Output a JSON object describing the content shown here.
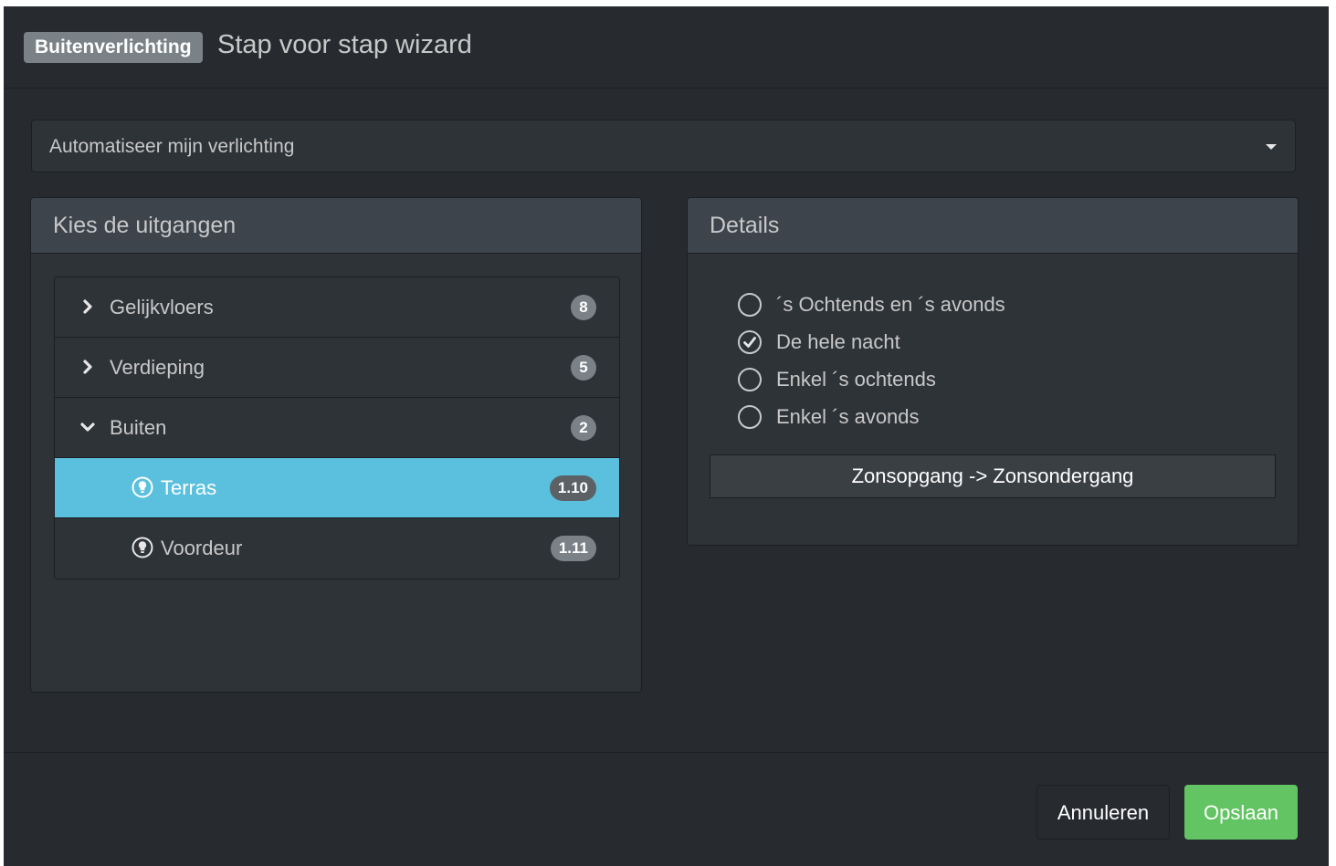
{
  "header": {
    "label": "Buitenverlichting",
    "title": "Stap voor stap wizard"
  },
  "select": {
    "value": "Automatiseer mijn verlichting",
    "icon": "caret-down-icon"
  },
  "outputs_panel": {
    "heading": "Kies de uitgangen",
    "groups": [
      {
        "label": "Gelijkvloers",
        "count": "8",
        "expanded": false,
        "icon": "chevron-right-icon"
      },
      {
        "label": "Verdieping",
        "count": "5",
        "expanded": false,
        "icon": "chevron-right-icon"
      },
      {
        "label": "Buiten",
        "count": "2",
        "expanded": true,
        "icon": "chevron-down-icon"
      }
    ],
    "children": [
      {
        "label": "Terras",
        "id": "1.10",
        "selected": true,
        "icon": "lightbulb-icon"
      },
      {
        "label": "Voordeur",
        "id": "1.11",
        "selected": false,
        "icon": "lightbulb-icon"
      }
    ]
  },
  "details_panel": {
    "heading": "Details",
    "options": [
      {
        "label": "´s Ochtends en ´s avonds",
        "checked": false
      },
      {
        "label": "De hele nacht",
        "checked": true
      },
      {
        "label": "Enkel ´s ochtends",
        "checked": false
      },
      {
        "label": "Enkel ´s avonds",
        "checked": false
      }
    ],
    "range": "Zonsopgang -> Zonsondergang"
  },
  "footer": {
    "cancel_label": "Annuleren",
    "save_label": "Opslaan"
  },
  "colors": {
    "background": "#272b30",
    "panel": "#2e3338",
    "panel_heading": "#3e444c",
    "active_row": "#5bc0de",
    "badge": "#7a8288",
    "success": "#62c462"
  }
}
